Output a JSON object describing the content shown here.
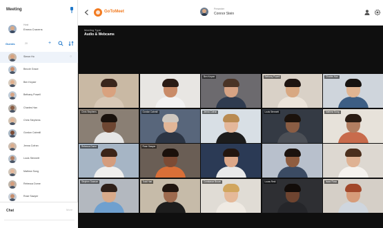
{
  "sidebar": {
    "title": "Meeting",
    "host": {
      "label": "Host",
      "name": "Emma Cravens"
    },
    "guests_label": "Guests",
    "guests_count": "20",
    "guests": [
      {
        "name": "Simon Ho"
      },
      {
        "name": "Beccie Grace"
      },
      {
        "name": "Ben Keyser"
      },
      {
        "name": "Bethany Powell"
      },
      {
        "name": "Charles Han"
      },
      {
        "name": "Chris Stephens"
      },
      {
        "name": "Gordon Cahmill"
      },
      {
        "name": "Jenna Cofran"
      },
      {
        "name": "Louis Stennett"
      },
      {
        "name": "Mathew Song"
      },
      {
        "name": "Rebecca Dome"
      },
      {
        "name": "Rose Sawyer"
      }
    ],
    "chat_label": "Chat",
    "chat_more": "More"
  },
  "topbar": {
    "logo_text": "GoToMeet",
    "presenter_label": "Presenter",
    "presenter_name": "Connor Stein"
  },
  "stage": {
    "meeting_type_label": "Meeting Type",
    "meeting_type": "Audio & Webcams"
  },
  "tiles": [
    {
      "name": "",
      "bg": "#c9b9a4",
      "skin": "#d9a27f",
      "hair": "#3a261c",
      "shirt": "#d8c8b6"
    },
    {
      "name": "",
      "bg": "#e8e6e3",
      "skin": "#c98b68",
      "hair": "#2a1b14",
      "shirt": "#f2f2f2"
    },
    {
      "name": "Ben Keyser",
      "bg": "#6c6a6e",
      "skin": "#d6a384",
      "hair": "#4a3426",
      "shirt": "#2f3b4f"
    },
    {
      "name": "Bethany Powell",
      "bg": "#d9d1c7",
      "skin": "#d8a882",
      "hair": "#1e1410",
      "shirt": "#ece4da"
    },
    {
      "name": "Charles Han",
      "bg": "#cfd5dc",
      "skin": "#e1b592",
      "hair": "#171310",
      "shirt": "#3d5e84"
    },
    {
      "name": "Chris Stephens",
      "bg": "#8a7f74",
      "skin": "#6d4632",
      "hair": "#1a120d",
      "shirt": "#e6e6e6"
    },
    {
      "name": "Gordon Cahmill",
      "bg": "#58667b",
      "skin": "#e2b697",
      "hair": "#cfc8c0",
      "shirt": "#2c3544"
    },
    {
      "name": "Jenna Cofran",
      "bg": "#d8dfe5",
      "skin": "#e4b79a",
      "hair": "#b98b52",
      "shirt": "#1c1c1c"
    },
    {
      "name": "Louis Stennett",
      "bg": "#343a44",
      "skin": "#8a5d44",
      "hair": "#1b120c",
      "shirt": "#4b4f56"
    },
    {
      "name": "Mathew Song",
      "bg": "#e7e2da",
      "skin": "#b27e61",
      "hair": "#2a1c14",
      "shirt": "#c86b4c"
    },
    {
      "name": "Rebecca Dome",
      "bg": "#a6b5c5",
      "skin": "#d59d7d",
      "hair": "#3b2418",
      "shirt": "#f0efed"
    },
    {
      "name": "Rose Sawyer",
      "bg": "#6a5e55",
      "skin": "#7c4b35",
      "hair": "#1a100b",
      "shirt": "#d96f38"
    },
    {
      "name": "",
      "bg": "#2b3a55",
      "skin": "#dca788",
      "hair": "#23160f",
      "shirt": "#e9e9e9"
    },
    {
      "name": "",
      "bg": "#b8c0cc",
      "skin": "#8f5d40",
      "hair": "#1c130e",
      "shirt": "#3b4b63"
    },
    {
      "name": "",
      "bg": "#ddd8d1",
      "skin": "#dfb293",
      "hair": "#4b2f1d",
      "shirt": "#f5f2ee"
    },
    {
      "name": "Stephen Dawson",
      "bg": "#b3b8bf",
      "skin": "#d8aa8a",
      "hair": "#2f2019",
      "shirt": "#6fa0cf"
    },
    {
      "name": "Todd Hart",
      "bg": "#c6bba9",
      "skin": "#9d6a4e",
      "hair": "#20150f",
      "shirt": "#1d1d1d"
    },
    {
      "name": "Constance Brown",
      "bg": "#e0dcd5",
      "skin": "#e5b999",
      "hair": "#d1a65e",
      "shirt": "#efeae3"
    },
    {
      "name": "Lucas Reid",
      "bg": "#2e2f33",
      "skin": "#6e4430",
      "hair": "#120c09",
      "shirt": "#25262a"
    },
    {
      "name": "Isaac Rosa",
      "bg": "#d5cfc7",
      "skin": "#d79c7a",
      "hair": "#a2482b",
      "shirt": "#cfd6de"
    }
  ],
  "colors": {
    "accent": "#1f77c9",
    "brand": "#f27b21",
    "stage": "#0f0f0f"
  }
}
